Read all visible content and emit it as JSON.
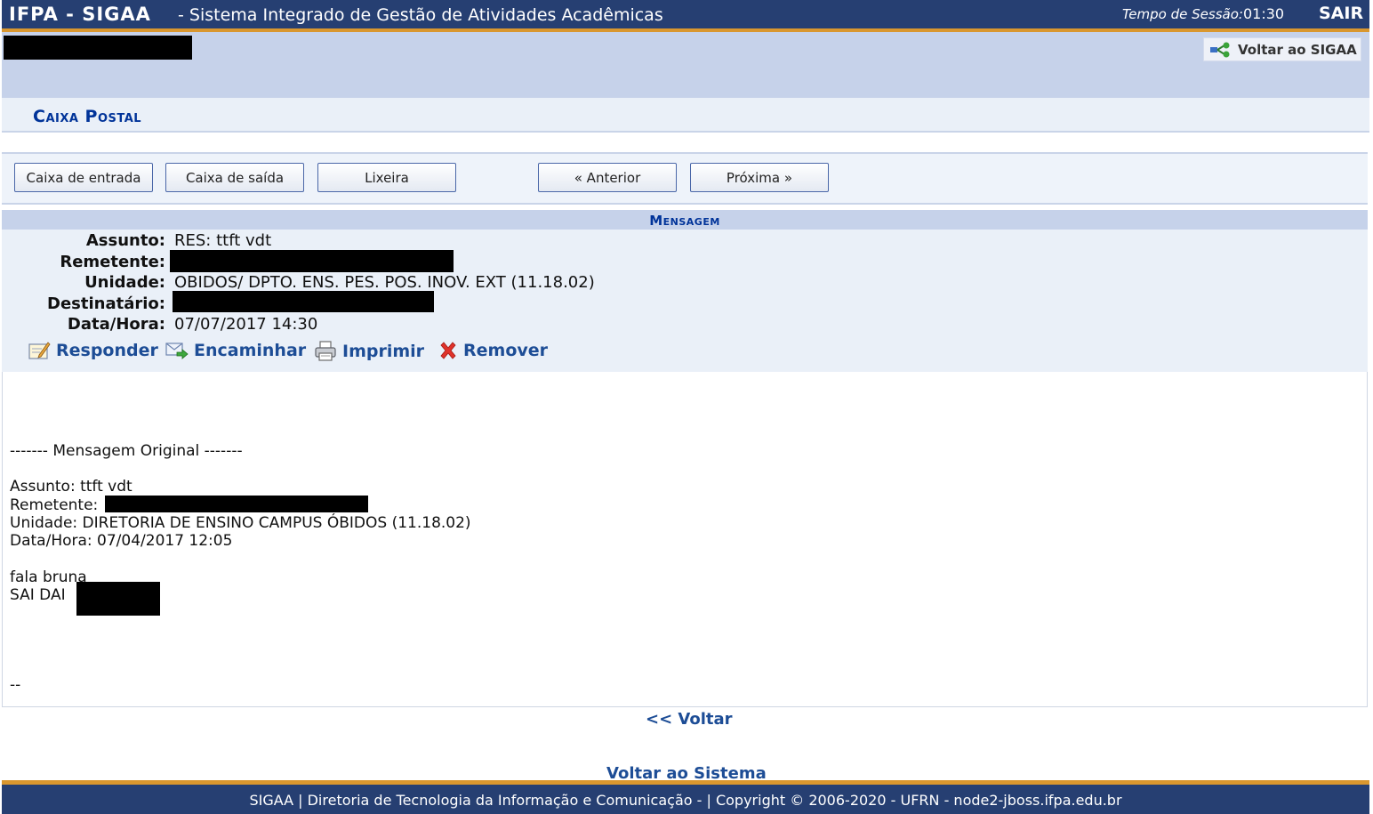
{
  "header": {
    "brand": "IFPA - SIGAA",
    "system_title": "- Sistema Integrado de Gestão de Atividades Acadêmicas",
    "session_label": "Tempo de Sessão:",
    "session_time": "01:30",
    "exit_label": "SAIR"
  },
  "info": {
    "user_name": "",
    "back_to_sigaa": "Voltar ao SIGAA",
    "back_icon": "share-network-icon"
  },
  "page": {
    "title": "Caixa Postal"
  },
  "toolbar": {
    "inbox": "Caixa de entrada",
    "outbox": "Caixa de saída",
    "trash": "Lixeira",
    "previous": "« Anterior",
    "next": "Próxima »"
  },
  "message": {
    "caption": "Mensagem",
    "fields": {
      "subject_label": "Assunto:",
      "subject_value": "RES: ttft vdt",
      "sender_label": "Remetente:",
      "sender_value": "",
      "unit_label": "Unidade:",
      "unit_value": "OBIDOS/ DPTO. ENS. PES. POS. INOV. EXT (11.18.02)",
      "recipient_label": "Destinatário:",
      "recipient_value": "",
      "datetime_label": "Data/Hora:",
      "datetime_value": "07/07/2017 14:30"
    },
    "actions": {
      "reply": "Responder",
      "forward": "Encaminhar",
      "print": "Imprimir",
      "remove": "Remover"
    },
    "body": {
      "original_header": "------- Mensagem Original -------",
      "subject_line": "Assunto: ttft vdt",
      "sender_line": "Remetente:",
      "unit_line": "Unidade: DIRETORIA DE ENSINO CAMPUS ÓBIDOS (11.18.02)",
      "datetime_line": "Data/Hora: 07/04/2017 12:05",
      "text_line1": "fala bruna",
      "text_line2": "SAI DAI",
      "signature": "--"
    }
  },
  "links": {
    "back": "<< Voltar",
    "back_to_system": "Voltar ao Sistema"
  },
  "footer": {
    "text": "SIGAA | Diretoria de Tecnologia da Informação e Comunicação - | Copyright © 2006-2020 - UFRN - node2-jboss.ifpa.edu.br"
  },
  "colors": {
    "topbar": "#263f72",
    "accent_orange": "#d9972f",
    "info_band": "#c6d2ea",
    "link_blue": "#1d4d96",
    "title_blue": "#003399"
  }
}
